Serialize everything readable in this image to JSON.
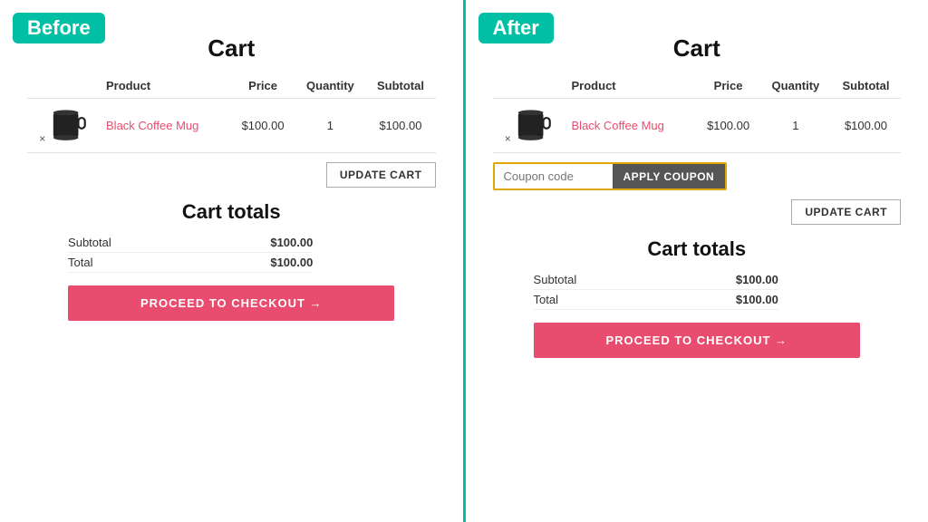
{
  "before": {
    "badge": "Before",
    "cart_title": "Cart",
    "table": {
      "headers": [
        "",
        "Product",
        "Price",
        "Quantity",
        "Subtotal"
      ],
      "row": {
        "remove": "×",
        "product_name": "Black Coffee Mug",
        "price": "$100.00",
        "quantity": "1",
        "subtotal": "$100.00"
      }
    },
    "update_cart_btn": "UPDATE CART",
    "cart_totals_title": "Cart totals",
    "subtotal_label": "Subtotal",
    "subtotal_value": "$100.00",
    "total_label": "Total",
    "total_value": "$100.00",
    "proceed_btn": "PROCEED TO CHECKOUT →"
  },
  "after": {
    "badge": "After",
    "cart_title": "Cart",
    "table": {
      "headers": [
        "",
        "Product",
        "Price",
        "Quantity",
        "Subtotal"
      ],
      "row": {
        "remove": "×",
        "product_name": "Black Coffee Mug",
        "price": "$100.00",
        "quantity": "1",
        "subtotal": "$100.00"
      }
    },
    "coupon_placeholder": "Coupon code",
    "apply_coupon_btn": "APPLY COUPON",
    "update_cart_btn": "UPDATE CART",
    "cart_totals_title": "Cart totals",
    "subtotal_label": "Subtotal",
    "subtotal_value": "$100.00",
    "total_label": "Total",
    "total_value": "$100.00",
    "proceed_btn": "PROCEED TO CHECKOUT →"
  },
  "colors": {
    "accent": "#00bfa5",
    "link": "#e84c6e",
    "proceed_bg": "#e84c6e",
    "coupon_border": "#e0a800"
  }
}
